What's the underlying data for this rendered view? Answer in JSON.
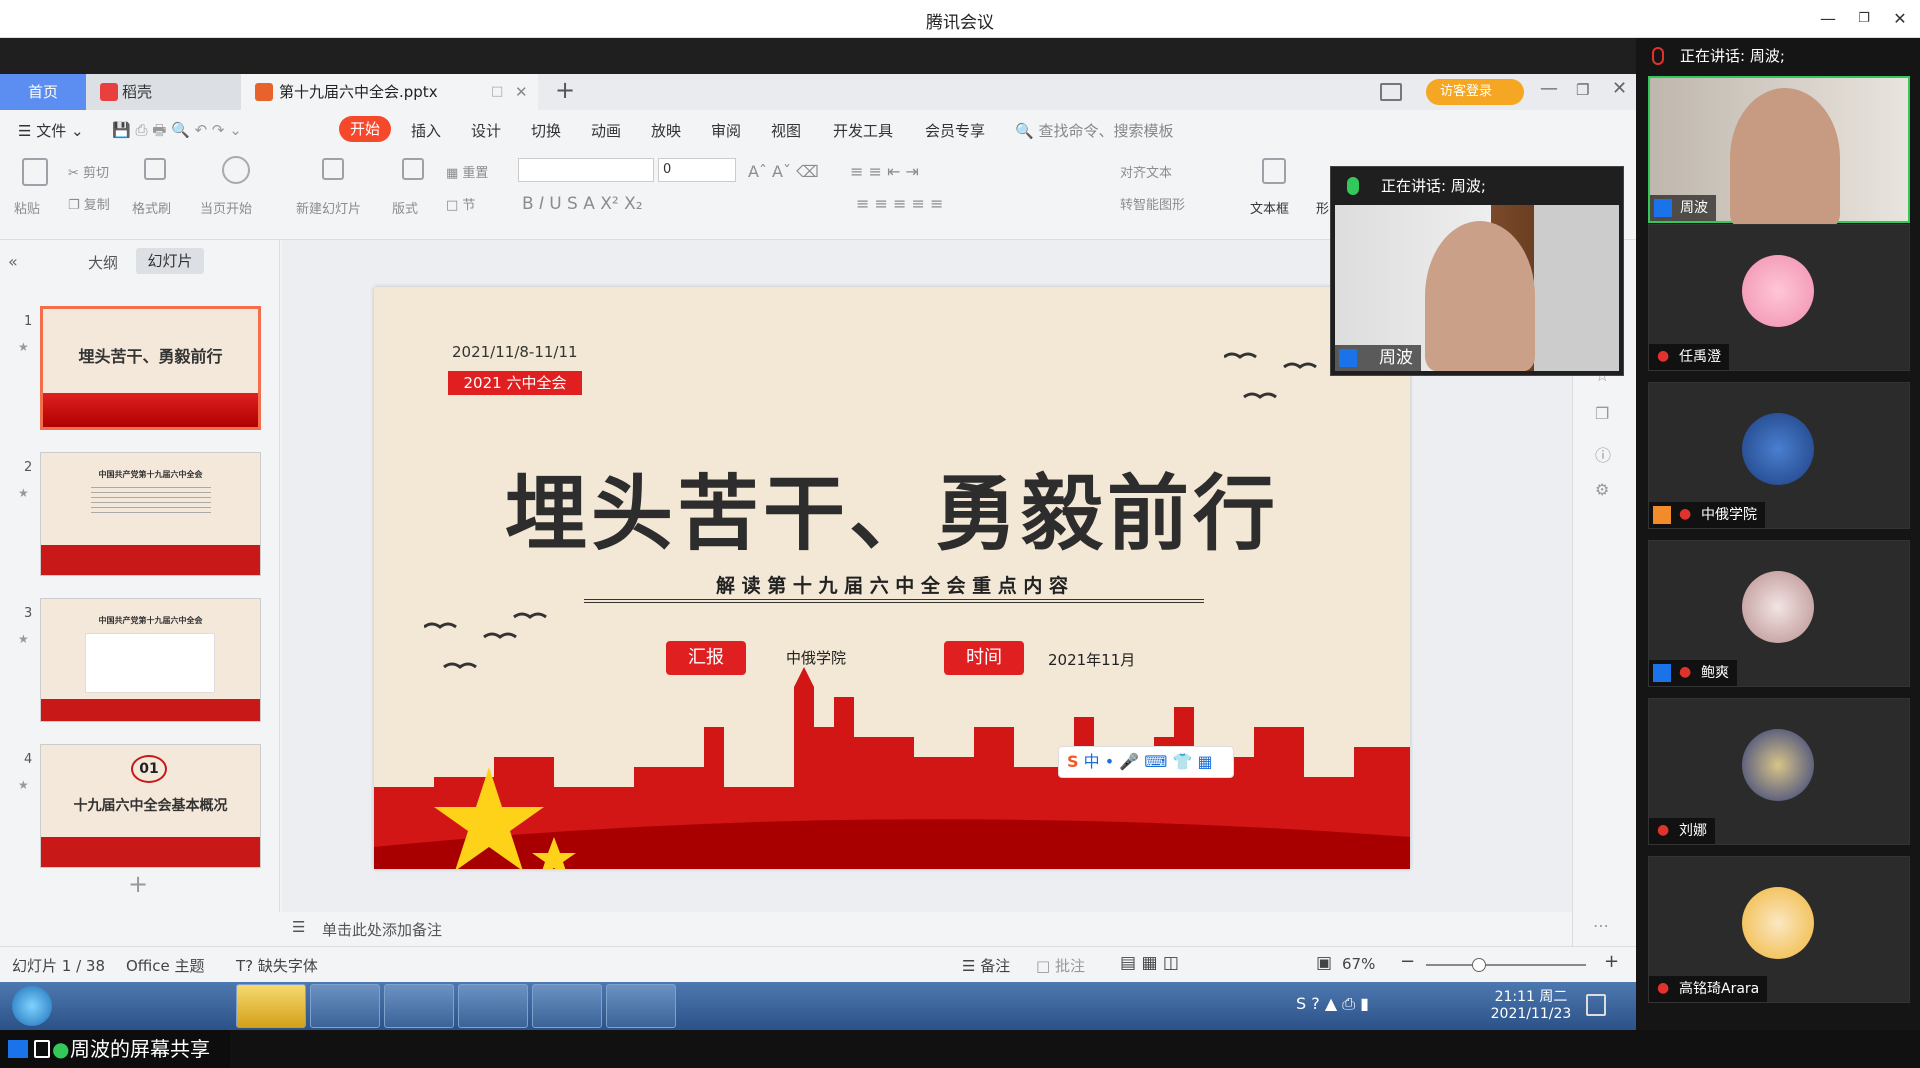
{
  "window": {
    "title": "腾讯会议"
  },
  "share": {
    "label": "周波的屏幕共享",
    "speaking_label": "正在讲话: 周波;"
  },
  "wps": {
    "tabs": [
      {
        "label": "首页"
      },
      {
        "label": "稻壳"
      },
      {
        "label": "第十九届六中全会.pptx"
      }
    ],
    "visitor_login": "访客登录",
    "menu": {
      "file": "文件",
      "items": [
        "开始",
        "插入",
        "设计",
        "切换",
        "动画",
        "放映",
        "审阅",
        "视图",
        "开发工具",
        "会员专享"
      ],
      "search": "查找命令、搜索模板"
    },
    "ribbon": {
      "paste": "粘贴",
      "cut": "剪切",
      "copy": "复制",
      "format_painter": "格式刷",
      "from_current": "当页开始",
      "new_slide": "新建幻灯片",
      "layout": "版式",
      "reset": "重置",
      "section": "节",
      "font_size": "0",
      "align_text": "对齐文本",
      "smart_art": "转智能图形",
      "textbox": "文本框",
      "shape": "形"
    },
    "panel_tabs": {
      "outline": "大纲",
      "slides": "幻灯片"
    },
    "thumbs": [
      {
        "num": "1",
        "title": "埋头苦干、勇毅前行"
      },
      {
        "num": "2",
        "title": "中国共产党第十九届六中全会"
      },
      {
        "num": "3",
        "title": "中国共产党第十九届六中全会"
      },
      {
        "num": "4",
        "badge": "01",
        "title": "十九届六中全会基本概况"
      }
    ],
    "notes_placeholder": "单击此处添加备注",
    "status": {
      "slide_info": "幻灯片 1 / 38",
      "theme": "Office 主题",
      "missing_font": "缺失字体",
      "notes": "备注",
      "comments": "批注",
      "zoom": "67%"
    }
  },
  "slide": {
    "date_range": "2021/11/8-11/11",
    "tag": "2021 六中全会",
    "title": "埋头苦干、勇毅前行",
    "subtitle": "解 读 第 十 九 届 六 中 全 会 重 点 内 容",
    "report_label": "汇报",
    "reporter": "中俄学院",
    "time_label": "时间",
    "time_value": "2021年11月"
  },
  "ime": {
    "lang": "中"
  },
  "taskbar": {
    "time": "21:11 周二",
    "date": "2021/11/23"
  },
  "participants": [
    {
      "name": "周波"
    },
    {
      "name": "任禹澄"
    },
    {
      "name": "中俄学院"
    },
    {
      "name": "鲍爽"
    },
    {
      "name": "刘娜"
    },
    {
      "name": "高铭琦Arara"
    }
  ],
  "floating_video": {
    "speaking_label": "正在讲话: 周波;",
    "name": "周波"
  }
}
